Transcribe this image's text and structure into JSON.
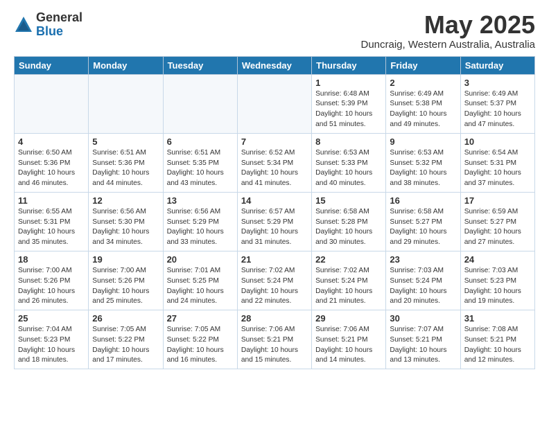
{
  "header": {
    "logo_general": "General",
    "logo_blue": "Blue",
    "month_title": "May 2025",
    "location": "Duncraig, Western Australia, Australia"
  },
  "weekdays": [
    "Sunday",
    "Monday",
    "Tuesday",
    "Wednesday",
    "Thursday",
    "Friday",
    "Saturday"
  ],
  "weeks": [
    [
      {
        "day": "",
        "info": ""
      },
      {
        "day": "",
        "info": ""
      },
      {
        "day": "",
        "info": ""
      },
      {
        "day": "",
        "info": ""
      },
      {
        "day": "1",
        "info": "Sunrise: 6:48 AM\nSunset: 5:39 PM\nDaylight: 10 hours\nand 51 minutes."
      },
      {
        "day": "2",
        "info": "Sunrise: 6:49 AM\nSunset: 5:38 PM\nDaylight: 10 hours\nand 49 minutes."
      },
      {
        "day": "3",
        "info": "Sunrise: 6:49 AM\nSunset: 5:37 PM\nDaylight: 10 hours\nand 47 minutes."
      }
    ],
    [
      {
        "day": "4",
        "info": "Sunrise: 6:50 AM\nSunset: 5:36 PM\nDaylight: 10 hours\nand 46 minutes."
      },
      {
        "day": "5",
        "info": "Sunrise: 6:51 AM\nSunset: 5:36 PM\nDaylight: 10 hours\nand 44 minutes."
      },
      {
        "day": "6",
        "info": "Sunrise: 6:51 AM\nSunset: 5:35 PM\nDaylight: 10 hours\nand 43 minutes."
      },
      {
        "day": "7",
        "info": "Sunrise: 6:52 AM\nSunset: 5:34 PM\nDaylight: 10 hours\nand 41 minutes."
      },
      {
        "day": "8",
        "info": "Sunrise: 6:53 AM\nSunset: 5:33 PM\nDaylight: 10 hours\nand 40 minutes."
      },
      {
        "day": "9",
        "info": "Sunrise: 6:53 AM\nSunset: 5:32 PM\nDaylight: 10 hours\nand 38 minutes."
      },
      {
        "day": "10",
        "info": "Sunrise: 6:54 AM\nSunset: 5:31 PM\nDaylight: 10 hours\nand 37 minutes."
      }
    ],
    [
      {
        "day": "11",
        "info": "Sunrise: 6:55 AM\nSunset: 5:31 PM\nDaylight: 10 hours\nand 35 minutes."
      },
      {
        "day": "12",
        "info": "Sunrise: 6:56 AM\nSunset: 5:30 PM\nDaylight: 10 hours\nand 34 minutes."
      },
      {
        "day": "13",
        "info": "Sunrise: 6:56 AM\nSunset: 5:29 PM\nDaylight: 10 hours\nand 33 minutes."
      },
      {
        "day": "14",
        "info": "Sunrise: 6:57 AM\nSunset: 5:29 PM\nDaylight: 10 hours\nand 31 minutes."
      },
      {
        "day": "15",
        "info": "Sunrise: 6:58 AM\nSunset: 5:28 PM\nDaylight: 10 hours\nand 30 minutes."
      },
      {
        "day": "16",
        "info": "Sunrise: 6:58 AM\nSunset: 5:27 PM\nDaylight: 10 hours\nand 29 minutes."
      },
      {
        "day": "17",
        "info": "Sunrise: 6:59 AM\nSunset: 5:27 PM\nDaylight: 10 hours\nand 27 minutes."
      }
    ],
    [
      {
        "day": "18",
        "info": "Sunrise: 7:00 AM\nSunset: 5:26 PM\nDaylight: 10 hours\nand 26 minutes."
      },
      {
        "day": "19",
        "info": "Sunrise: 7:00 AM\nSunset: 5:26 PM\nDaylight: 10 hours\nand 25 minutes."
      },
      {
        "day": "20",
        "info": "Sunrise: 7:01 AM\nSunset: 5:25 PM\nDaylight: 10 hours\nand 24 minutes."
      },
      {
        "day": "21",
        "info": "Sunrise: 7:02 AM\nSunset: 5:24 PM\nDaylight: 10 hours\nand 22 minutes."
      },
      {
        "day": "22",
        "info": "Sunrise: 7:02 AM\nSunset: 5:24 PM\nDaylight: 10 hours\nand 21 minutes."
      },
      {
        "day": "23",
        "info": "Sunrise: 7:03 AM\nSunset: 5:24 PM\nDaylight: 10 hours\nand 20 minutes."
      },
      {
        "day": "24",
        "info": "Sunrise: 7:03 AM\nSunset: 5:23 PM\nDaylight: 10 hours\nand 19 minutes."
      }
    ],
    [
      {
        "day": "25",
        "info": "Sunrise: 7:04 AM\nSunset: 5:23 PM\nDaylight: 10 hours\nand 18 minutes."
      },
      {
        "day": "26",
        "info": "Sunrise: 7:05 AM\nSunset: 5:22 PM\nDaylight: 10 hours\nand 17 minutes."
      },
      {
        "day": "27",
        "info": "Sunrise: 7:05 AM\nSunset: 5:22 PM\nDaylight: 10 hours\nand 16 minutes."
      },
      {
        "day": "28",
        "info": "Sunrise: 7:06 AM\nSunset: 5:21 PM\nDaylight: 10 hours\nand 15 minutes."
      },
      {
        "day": "29",
        "info": "Sunrise: 7:06 AM\nSunset: 5:21 PM\nDaylight: 10 hours\nand 14 minutes."
      },
      {
        "day": "30",
        "info": "Sunrise: 7:07 AM\nSunset: 5:21 PM\nDaylight: 10 hours\nand 13 minutes."
      },
      {
        "day": "31",
        "info": "Sunrise: 7:08 AM\nSunset: 5:21 PM\nDaylight: 10 hours\nand 12 minutes."
      }
    ]
  ]
}
